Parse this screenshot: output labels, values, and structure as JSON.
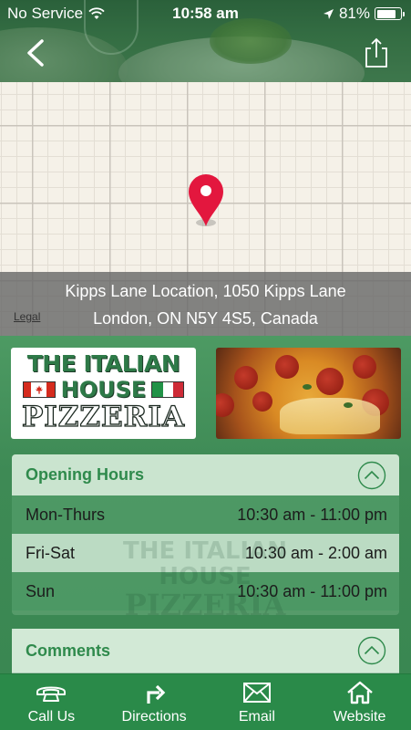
{
  "status_bar": {
    "carrier": "No Service",
    "time": "10:58 am",
    "battery_percent": "81%",
    "battery_level": 0.81
  },
  "header": {
    "back_icon": "chevron-left-icon",
    "share_icon": "share-icon"
  },
  "map": {
    "pin_icon": "map-pin-icon",
    "pin_color": "#e3173e",
    "address_line1": "Kipps Lane Location, 1050 Kipps Lane",
    "address_line2": "London, ON N5Y 4S5, Canada",
    "legal": "Legal"
  },
  "logo": {
    "line1": "THE ITALIAN",
    "line2": "HOUSE",
    "line3": "PIZZERIA"
  },
  "opening_hours": {
    "title": "Opening Hours",
    "rows": [
      {
        "day": "Mon-Thurs",
        "hours": "10:30 am - 11:00 pm"
      },
      {
        "day": "Fri-Sat",
        "hours": "10:30 am - 2:00 am"
      },
      {
        "day": "Sun",
        "hours": "10:30 am - 11:00 pm"
      }
    ]
  },
  "comments": {
    "title": "Comments"
  },
  "tabbar": {
    "items": [
      {
        "label": "Call Us",
        "icon": "phone-icon"
      },
      {
        "label": "Directions",
        "icon": "directions-arrow-icon"
      },
      {
        "label": "Email",
        "icon": "envelope-icon"
      },
      {
        "label": "Website",
        "icon": "home-icon"
      }
    ]
  },
  "colors": {
    "brand_green": "#2a8a49",
    "title_green": "#2f8a4c"
  }
}
